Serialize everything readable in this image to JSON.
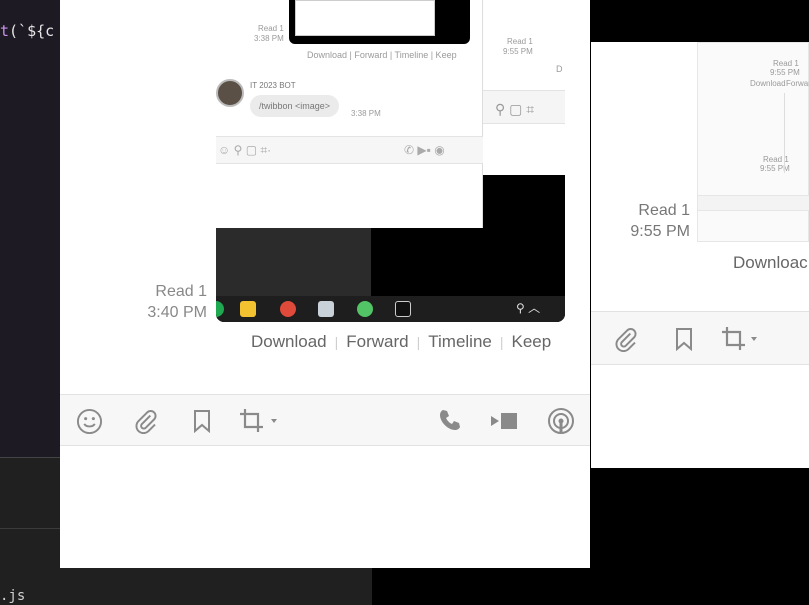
{
  "editor": {
    "code_prefix": "t",
    "code_rest": "(`${c",
    "file_name": ".js"
  },
  "main_chat": {
    "read_label": "Read 1",
    "read_time": "3:40 PM",
    "actions": [
      "Download",
      "Forward",
      "Timeline",
      "Keep"
    ],
    "toolbar_icons": [
      "emoji-icon",
      "attachment-icon",
      "bookmark-icon",
      "crop-icon",
      "phone-icon",
      "video-icon",
      "broadcast-icon"
    ]
  },
  "inner_screenshot": {
    "bot_name": "IT 2023 BOT",
    "bot_message": "/twibbon <image>",
    "bot_time": "3:38 PM",
    "read_top": "Read 1",
    "read_top_time": "3:38 PM",
    "actions_small": "Download | Forward | Timeline | Keep",
    "read_right": "Read 1",
    "read_right_time": "9:55 PM",
    "partial_letter": "D"
  },
  "right_chat": {
    "read_label": "Read 1",
    "read_time": "9:55 PM",
    "download_partial": "Downloac",
    "thumb_download": "Download",
    "thumb_forward": "Forwar",
    "thumb_read_top": "Read 1",
    "thumb_read_top_time": "9:55 PM",
    "thumb_read_bottom": "Read 1",
    "thumb_read_bottom_time": "9:55 PM"
  },
  "colors": {
    "accent_text": "#666666",
    "meta_text": "#888888",
    "icon": "#8a8a8a",
    "editor_bg": "#1e1a24"
  }
}
